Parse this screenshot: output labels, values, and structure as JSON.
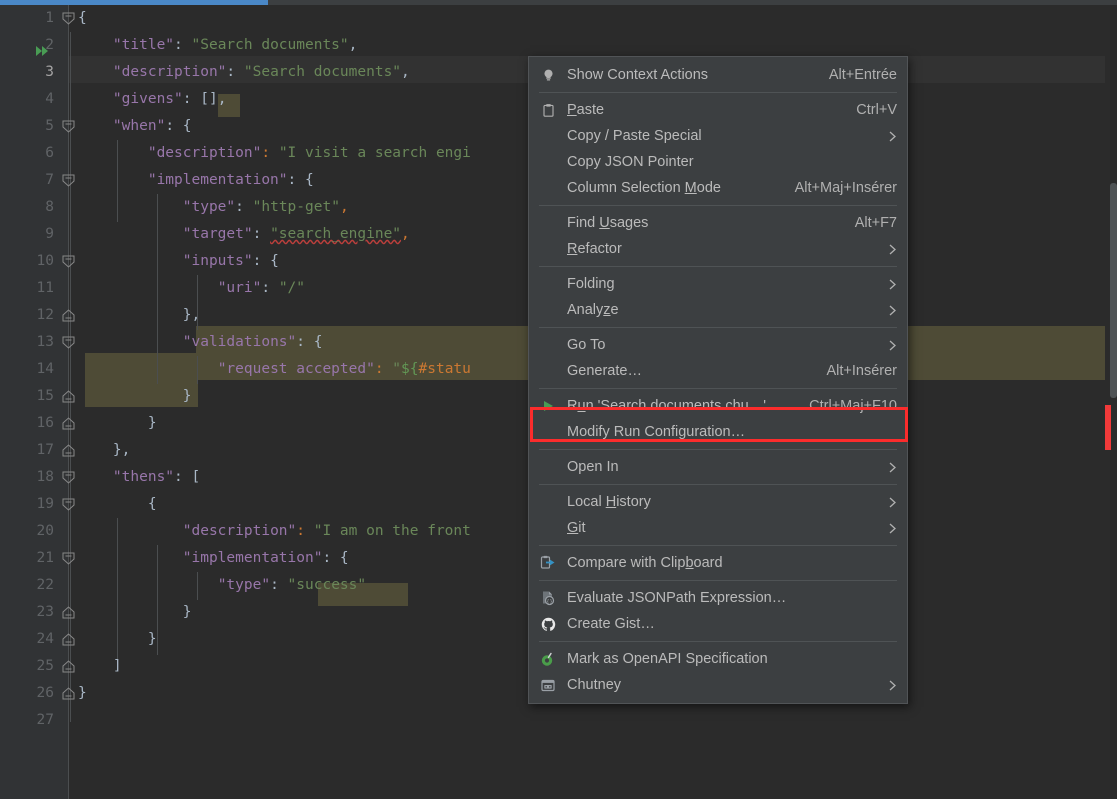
{
  "app": {
    "theme": "darcula",
    "accent_blue": "#4a88c7",
    "highlight_olive": "#4e4b36",
    "red_box": "#fb2c2c"
  },
  "progress": {
    "percent": 24,
    "label": ""
  },
  "editor": {
    "language": "json",
    "first_line": 1,
    "last_line": 27,
    "current_line": 3,
    "line_numbers": [
      "1",
      "2",
      "3",
      "4",
      "5",
      "6",
      "7",
      "8",
      "9",
      "10",
      "11",
      "12",
      "13",
      "14",
      "15",
      "16",
      "17",
      "18",
      "19",
      "20",
      "21",
      "22",
      "23",
      "24",
      "25",
      "26",
      "27"
    ],
    "lines": [
      {
        "n": 1,
        "text": "{"
      },
      {
        "n": 2,
        "text": "    \"title\": \"Search documents\","
      },
      {
        "n": 3,
        "text": "    \"description\": \"Search documents\","
      },
      {
        "n": 4,
        "text": "    \"givens\": [],"
      },
      {
        "n": 5,
        "text": "    \"when\": {"
      },
      {
        "n": 6,
        "text": "        \"description\": \"I visit a search engi"
      },
      {
        "n": 7,
        "text": "        \"implementation\": {"
      },
      {
        "n": 8,
        "text": "            \"type\": \"http-get\","
      },
      {
        "n": 9,
        "text": "            \"target\": \"search_engine\","
      },
      {
        "n": 10,
        "text": "            \"inputs\": {"
      },
      {
        "n": 11,
        "text": "                \"uri\": \"/\""
      },
      {
        "n": 12,
        "text": "            },"
      },
      {
        "n": 13,
        "text": "            \"validations\": {"
      },
      {
        "n": 14,
        "text": "                \"request accepted\": \"${#statu"
      },
      {
        "n": 15,
        "text": "            }"
      },
      {
        "n": 16,
        "text": "        }"
      },
      {
        "n": 17,
        "text": "    },"
      },
      {
        "n": 18,
        "text": "    \"thens\": ["
      },
      {
        "n": 19,
        "text": "        {"
      },
      {
        "n": 20,
        "text": "            \"description\": \"I am on the front"
      },
      {
        "n": 21,
        "text": "            \"implementation\": {"
      },
      {
        "n": 22,
        "text": "                \"type\": \"success\""
      },
      {
        "n": 23,
        "text": "            }"
      },
      {
        "n": 24,
        "text": "        }"
      },
      {
        "n": 25,
        "text": "    ]"
      },
      {
        "n": 26,
        "text": "}"
      },
      {
        "n": 27,
        "text": ""
      }
    ],
    "tokens": {
      "title_key": "\"title\"",
      "title_value": "\"Search documents\"",
      "description_key": "\"description\"",
      "description_value": "\"Search documents\"",
      "givens_key": "\"givens\"",
      "givens_value": "[]",
      "when_key": "\"when\"",
      "when_description_value": "\"I visit a search engi",
      "implementation_key": "\"implementation\"",
      "type_key": "\"type\"",
      "http_get_value": "\"http-get\"",
      "target_key": "\"target\"",
      "target_value": "\"search_engine\"",
      "inputs_key": "\"inputs\"",
      "uri_key": "\"uri\"",
      "uri_value": "\"/\"",
      "validations_key": "\"validations\"",
      "request_accepted_key": "\"request accepted\"",
      "request_accepted_value": "\"${#statu",
      "thens_key": "\"thens\"",
      "then_description_value": "\"I am on the front",
      "success_value": "\"success\""
    },
    "gutter": {
      "run_marker_icon": "double-chevron-run-icon",
      "run_marker_line": 2
    }
  },
  "context_menu": {
    "groups": [
      {
        "items": [
          {
            "icon": "lightbulb-icon",
            "label": "Show Context Actions",
            "accel": "Alt+Entrée",
            "submenu": false,
            "mnemonic": ""
          }
        ]
      },
      {
        "items": [
          {
            "icon": "clipboard-paste-icon",
            "label": "Paste",
            "accel": "Ctrl+V",
            "submenu": false,
            "mnemonic": "P"
          },
          {
            "icon": "",
            "label": "Copy / Paste Special",
            "accel": "",
            "submenu": true,
            "mnemonic": ""
          },
          {
            "icon": "",
            "label": "Copy JSON Pointer",
            "accel": "",
            "submenu": false,
            "mnemonic": ""
          },
          {
            "icon": "",
            "label": "Column Selection Mode",
            "accel": "Alt+Maj+Insérer",
            "submenu": false,
            "mnemonic": "M"
          }
        ]
      },
      {
        "items": [
          {
            "icon": "",
            "label": "Find Usages",
            "accel": "Alt+F7",
            "submenu": false,
            "mnemonic": "U"
          },
          {
            "icon": "",
            "label": "Refactor",
            "accel": "",
            "submenu": true,
            "mnemonic": "R"
          }
        ]
      },
      {
        "items": [
          {
            "icon": "",
            "label": "Folding",
            "accel": "",
            "submenu": true,
            "mnemonic": ""
          },
          {
            "icon": "",
            "label": "Analyze",
            "accel": "",
            "submenu": true,
            "mnemonic": "z"
          }
        ]
      },
      {
        "items": [
          {
            "icon": "",
            "label": "Go To",
            "accel": "",
            "submenu": true,
            "mnemonic": ""
          },
          {
            "icon": "",
            "label": "Generate…",
            "accel": "Alt+Insérer",
            "submenu": false,
            "mnemonic": ""
          }
        ]
      },
      {
        "items": [
          {
            "icon": "run-play-icon",
            "label": "Run 'Search documents.chu…'",
            "accel": "Ctrl+Maj+F10",
            "submenu": false,
            "mnemonic": "u",
            "highlighted": true
          },
          {
            "icon": "",
            "label": "Modify Run Configuration…",
            "accel": "",
            "submenu": false,
            "mnemonic": ""
          }
        ]
      },
      {
        "items": [
          {
            "icon": "",
            "label": "Open In",
            "accel": "",
            "submenu": true,
            "mnemonic": ""
          }
        ]
      },
      {
        "items": [
          {
            "icon": "",
            "label": "Local History",
            "accel": "",
            "submenu": true,
            "mnemonic": "H"
          },
          {
            "icon": "",
            "label": "Git",
            "accel": "",
            "submenu": true,
            "mnemonic": "G"
          }
        ]
      },
      {
        "items": [
          {
            "icon": "compare-clipboard-icon",
            "label": "Compare with Clipboard",
            "accel": "",
            "submenu": false,
            "mnemonic": "b"
          }
        ]
      },
      {
        "items": [
          {
            "icon": "jsonpath-icon",
            "label": "Evaluate JSONPath Expression…",
            "accel": "",
            "submenu": false,
            "mnemonic": ""
          },
          {
            "icon": "github-icon",
            "label": "Create Gist…",
            "accel": "",
            "submenu": false,
            "mnemonic": ""
          }
        ]
      },
      {
        "items": [
          {
            "icon": "openapi-icon",
            "label": "Mark as OpenAPI Specification",
            "accel": "",
            "submenu": false,
            "mnemonic": ""
          },
          {
            "icon": "chutney-icon",
            "label": "Chutney",
            "accel": "",
            "submenu": true,
            "mnemonic": ""
          }
        ]
      }
    ]
  }
}
